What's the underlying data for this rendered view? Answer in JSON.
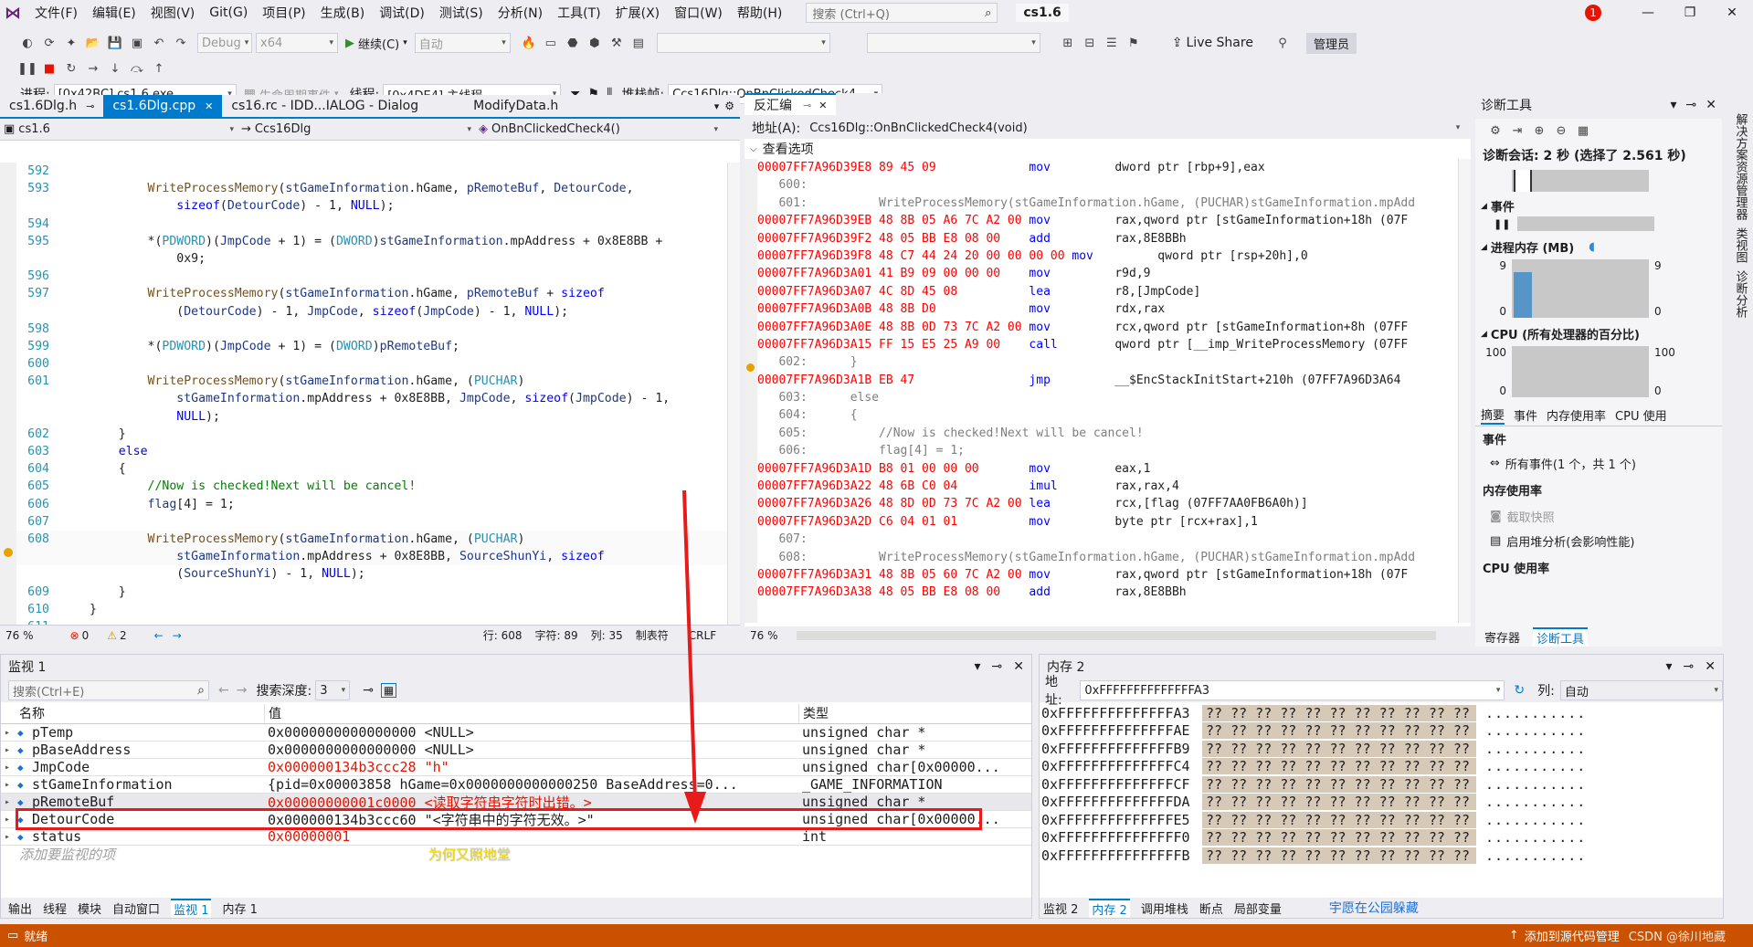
{
  "menu": {
    "items": [
      "文件(F)",
      "编辑(E)",
      "视图(V)",
      "Git(G)",
      "项目(P)",
      "生成(B)",
      "调试(D)",
      "测试(S)",
      "分析(N)",
      "工具(T)",
      "扩展(X)",
      "窗口(W)",
      "帮助(H)"
    ],
    "search_placeholder": "搜索 (Ctrl+Q)",
    "solution_name": "cs1.6",
    "notification_count": "1"
  },
  "toolbar": {
    "config": "Debug",
    "platform": "x64",
    "continue_label": "继续(C)",
    "auto_label": "自动",
    "live_share": "Live Share",
    "admin": "管理员"
  },
  "debugbar": {
    "process_label": "进程:",
    "process_value": "[0x42BC] cs1.6.exe",
    "lifecycle_label": "生命周期事件",
    "thread_label": "线程:",
    "thread_value": "[0x4DE4] 主线程",
    "stackframe_label": "堆栈帧:",
    "stackframe_value": "Ccs16Dlg::OnBnClickedCheck4"
  },
  "editor": {
    "tabs": [
      "cs1.6Dlg.h",
      "cs1.6Dlg.cpp",
      "cs16.rc - IDD...IALOG - Dialog",
      "ModifyData.h"
    ],
    "nav_project": "cs1.6",
    "nav_class": "Ccs16Dlg",
    "nav_method": "OnBnClickedCheck4()",
    "status": {
      "zoom": "76 %",
      "errors": "0",
      "warnings": "2",
      "line": "行: 608",
      "char": "字符: 89",
      "col": "列: 35",
      "tab": "制表符",
      "eol": "CRLF"
    }
  },
  "code_lines": [
    {
      "n": "592",
      "t": ""
    },
    {
      "n": "593",
      "t": "        WriteProcessMemory(stGameInformation.hGame, pRemoteBuf, DetourCode,"
    },
    {
      "n": "",
      "t": "            sizeof(DetourCode) - 1, NULL);"
    },
    {
      "n": "594",
      "t": ""
    },
    {
      "n": "595",
      "t": "        *(PDWORD)(JmpCode + 1) = (DWORD)stGameInformation.mpAddress + 0x8E8BB +"
    },
    {
      "n": "",
      "t": "            0x9;"
    },
    {
      "n": "596",
      "t": ""
    },
    {
      "n": "597",
      "t": "        WriteProcessMemory(stGameInformation.hGame, pRemoteBuf + sizeof"
    },
    {
      "n": "",
      "t": "            (DetourCode) - 1, JmpCode, sizeof(JmpCode) - 1, NULL);"
    },
    {
      "n": "598",
      "t": ""
    },
    {
      "n": "599",
      "t": "        *(PDWORD)(JmpCode + 1) = (DWORD)pRemoteBuf;"
    },
    {
      "n": "600",
      "t": ""
    },
    {
      "n": "601",
      "t": "        WriteProcessMemory(stGameInformation.hGame, (PUCHAR)"
    },
    {
      "n": "",
      "t": "            stGameInformation.mpAddress + 0x8E8BB, JmpCode, sizeof(JmpCode) - 1,"
    },
    {
      "n": "",
      "t": "            NULL);"
    },
    {
      "n": "602",
      "t": "    }"
    },
    {
      "n": "603",
      "t": "    else"
    },
    {
      "n": "604",
      "t": "    {"
    },
    {
      "n": "605",
      "t": "        //Now is checked!Next will be cancel!"
    },
    {
      "n": "606",
      "t": "        flag[4] = 1;"
    },
    {
      "n": "607",
      "t": ""
    },
    {
      "n": "608",
      "t": "        WriteProcessMemory(stGameInformation.hGame, (PUCHAR)"
    },
    {
      "n": "",
      "t": "            stGameInformation.mpAddress + 0x8E8BB, SourceShunYi, sizeof"
    },
    {
      "n": "",
      "t": "            (SourceShunYi) - 1, NULL);"
    },
    {
      "n": "609",
      "t": "    }"
    },
    {
      "n": "610",
      "t": "}"
    },
    {
      "n": "611",
      "t": ""
    }
  ],
  "disasm": {
    "title": "反汇编",
    "address_label": "地址(A):",
    "address_value": "Ccs16Dlg::OnBnClickedCheck4(void)",
    "view_options": "查看选项",
    "zoom": "76 %",
    "lines": [
      {
        "k": "a",
        "t": "00007FF7A96D39E8 89 45 09             mov         dword ptr [rbp+9],eax"
      },
      {
        "k": "s",
        "t": "   600:"
      },
      {
        "k": "s",
        "t": "   601:          WriteProcessMemory(stGameInformation.hGame, (PUCHAR)stGameInformation.mpAdd"
      },
      {
        "k": "a",
        "t": "00007FF7A96D39EB 48 8B 05 A6 7C A2 00 mov         rax,qword ptr [stGameInformation+18h (07F"
      },
      {
        "k": "a",
        "t": "00007FF7A96D39F2 48 05 BB E8 08 00    add         rax,8E8BBh"
      },
      {
        "k": "a",
        "t": "00007FF7A96D39F8 48 C7 44 24 20 00 00 00 00 mov         qword ptr [rsp+20h],0"
      },
      {
        "k": "a",
        "t": "00007FF7A96D3A01 41 B9 09 00 00 00    mov         r9d,9"
      },
      {
        "k": "a",
        "t": "00007FF7A96D3A07 4C 8D 45 08          lea         r8,[JmpCode]"
      },
      {
        "k": "a",
        "t": "00007FF7A96D3A0B 48 8B D0             mov         rdx,rax"
      },
      {
        "k": "a",
        "t": "00007FF7A96D3A0E 48 8B 0D 73 7C A2 00 mov         rcx,qword ptr [stGameInformation+8h (07FF"
      },
      {
        "k": "a",
        "t": "00007FF7A96D3A15 FF 15 E5 25 A9 00    call        qword ptr [__imp_WriteProcessMemory (07FF"
      },
      {
        "k": "s",
        "t": "   602:      }"
      },
      {
        "k": "a",
        "t": "00007FF7A96D3A1B EB 47                jmp         __$EncStackInitStart+210h (07FF7A96D3A64"
      },
      {
        "k": "s",
        "t": "   603:      else"
      },
      {
        "k": "s",
        "t": "   604:      {"
      },
      {
        "k": "s",
        "t": "   605:          //Now is checked!Next will be cancel!"
      },
      {
        "k": "s",
        "t": "   606:          flag[4] = 1;"
      },
      {
        "k": "a",
        "t": "00007FF7A96D3A1D B8 01 00 00 00       mov         eax,1"
      },
      {
        "k": "a",
        "t": "00007FF7A96D3A22 48 6B C0 04          imul        rax,rax,4"
      },
      {
        "k": "a",
        "t": "00007FF7A96D3A26 48 8D 0D 73 7C A2 00 lea         rcx,[flag (07FF7AA0FB6A0h)]"
      },
      {
        "k": "a",
        "t": "00007FF7A96D3A2D C6 04 01 01          mov         byte ptr [rcx+rax],1"
      },
      {
        "k": "s",
        "t": "   607:"
      },
      {
        "k": "s",
        "t": "   608:          WriteProcessMemory(stGameInformation.hGame, (PUCHAR)stGameInformation.mpAdd"
      },
      {
        "k": "a",
        "t": "00007FF7A96D3A31 48 8B 05 60 7C A2 00 mov         rax,qword ptr [stGameInformation+18h (07F"
      },
      {
        "k": "a",
        "t": "00007FF7A96D3A38 48 05 BB E8 08 00    add         rax,8E8BBh"
      }
    ]
  },
  "diagnostics": {
    "title": "诊断工具",
    "session": "诊断会话: 2 秒 (选择了 2.561 秒)",
    "events_label": "事件",
    "process_memory": "进程内存 (MB)",
    "mem_max": "9",
    "mem_min": "0",
    "cpu_label": "CPU (所有处理器的百分比)",
    "cpu_max": "100",
    "cpu_min": "0",
    "tabs": [
      "摘要",
      "事件",
      "内存使用率",
      "CPU 使用"
    ],
    "section_events": "事件",
    "all_events": "所有事件(1 个，共 1 个)",
    "section_memory": "内存使用率",
    "snapshot": "截取快照",
    "heap_analysis": "启用堆分析(会影响性能)",
    "section_cpu": "CPU 使用率",
    "bottom_tabs": [
      "寄存器",
      "诊断工具"
    ]
  },
  "side_tabs": [
    "解决方案资源管理器",
    "类视图",
    "诊断分析"
  ],
  "watch": {
    "title": "监视 1",
    "search_placeholder": "搜索(Ctrl+E)",
    "depth_label": "搜索深度:",
    "depth_value": "3",
    "col_name": "名称",
    "col_value": "值",
    "col_type": "类型",
    "rows": [
      {
        "name": "pTemp",
        "value": "0x0000000000000000 <NULL>",
        "type": "unsigned char *",
        "red": false
      },
      {
        "name": "pBaseAddress",
        "value": "0x0000000000000000 <NULL>",
        "type": "unsigned char *",
        "red": false
      },
      {
        "name": "JmpCode",
        "value": "0x000000134b3ccc28 \"h\"",
        "type": "unsigned char[0x00000...",
        "red": true
      },
      {
        "name": "stGameInformation",
        "value": "{pid=0x00003858 hGame=0x0000000000000250 BaseAddress=0...",
        "type": "_GAME_INFORMATION",
        "red": false
      },
      {
        "name": "pRemoteBuf",
        "value": "0x00000000001c0000 <读取字符串字符时出错。>",
        "type": "unsigned char *",
        "red": true
      },
      {
        "name": "DetourCode",
        "value": "0x000000134b3ccc60 \"<字符串中的字符无效。>\"",
        "type": "unsigned char[0x00000...",
        "red": false
      },
      {
        "name": "status",
        "value": "0x00000001",
        "type": "int",
        "red": true
      }
    ],
    "add_placeholder": "添加要监视的项",
    "overlay_text": "为何又照地堂",
    "bottom_tabs": [
      "输出",
      "线程",
      "模块",
      "自动窗口",
      "监视 1",
      "内存 1"
    ]
  },
  "memory": {
    "title": "内存 2",
    "address_label": "地址:",
    "address_value": "0xFFFFFFFFFFFFFFA3",
    "columns_label": "列:",
    "columns_value": "自动",
    "rows": [
      "0xFFFFFFFFFFFFFFA3",
      "0xFFFFFFFFFFFFFFAE",
      "0xFFFFFFFFFFFFFFB9",
      "0xFFFFFFFFFFFFFFC4",
      "0xFFFFFFFFFFFFFFCF",
      "0xFFFFFFFFFFFFFFDA",
      "0xFFFFFFFFFFFFFFE5",
      "0xFFFFFFFFFFFFFFF0",
      "0xFFFFFFFFFFFFFFFB"
    ],
    "bytes": "?? ?? ?? ?? ?? ?? ?? ?? ?? ?? ??",
    "ascii": "...........",
    "bottom_tabs": [
      "监视 2",
      "内存 2",
      "调用堆栈",
      "断点",
      "局部变量"
    ],
    "overlay_text": "宇愿在公园躲藏"
  },
  "statusbar": {
    "ready": "就绪",
    "add_source": "添加到源代码管理",
    "watermark": "CSDN @徐川地藏"
  },
  "colors": {
    "accent": "#007acc",
    "status_orange": "#ca5100",
    "error_red": "#e51400"
  }
}
